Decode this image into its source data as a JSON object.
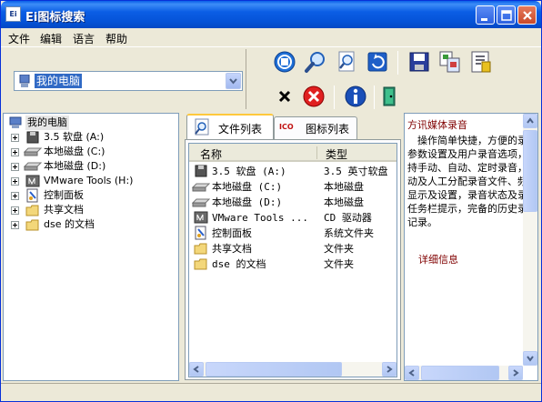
{
  "window": {
    "title": "Ei图标搜索",
    "app_icon_text": "Ei"
  },
  "menu": [
    "文件",
    "编辑",
    "语言",
    "帮助"
  ],
  "toolbar": {
    "location_value": "我的电脑",
    "buttons_row1": [
      "stop-icon",
      "search-icon",
      "find-file-icon",
      "refresh-icon",
      "save-icon",
      "copy-icon",
      "export-icon"
    ],
    "buttons_row2": [
      "clear-icon",
      "delete-icon",
      "info-icon",
      "exit-icon"
    ]
  },
  "tree": {
    "root": "我的电脑",
    "items": [
      {
        "label": "3.5 软盘 (A:)",
        "icon": "floppy-icon"
      },
      {
        "label": "本地磁盘 (C:)",
        "icon": "disk-icon"
      },
      {
        "label": "本地磁盘 (D:)",
        "icon": "disk-icon"
      },
      {
        "label": "VMware Tools (H:)",
        "icon": "cdrom-icon"
      },
      {
        "label": "控制面板",
        "icon": "control-panel-icon"
      },
      {
        "label": "共享文档",
        "icon": "folder-icon"
      },
      {
        "label": "dse 的文档",
        "icon": "folder-icon"
      }
    ]
  },
  "tabs": [
    {
      "label": "文件列表",
      "icon": "file-list-icon",
      "active": true
    },
    {
      "label": "图标列表",
      "icon": "ico-icon",
      "active": false
    }
  ],
  "ico_badge": "ICO",
  "listview": {
    "columns": [
      "名称",
      "类型"
    ],
    "rows": [
      {
        "name": "3.5 软盘 (A:)",
        "type": "3.5 英寸软盘",
        "icon": "floppy-icon"
      },
      {
        "name": "本地磁盘 (C:)",
        "type": "本地磁盘",
        "icon": "disk-icon"
      },
      {
        "name": "本地磁盘 (D:)",
        "type": "本地磁盘",
        "icon": "disk-icon"
      },
      {
        "name": "VMware Tools ...",
        "type": "CD 驱动器",
        "icon": "cdrom-icon"
      },
      {
        "name": "控制面板",
        "type": "系统文件夹",
        "icon": "control-panel-icon"
      },
      {
        "name": "共享文档",
        "type": "文件夹",
        "icon": "folder-icon"
      },
      {
        "name": "dse 的文档",
        "type": "文件夹",
        "icon": "folder-icon"
      }
    ]
  },
  "info": {
    "title": "方讯媒体录音",
    "body": "　操作简单快捷，方便的录样参数设置及用户录音选项，支持手动、自动、定时录音，自动及人工分配录音文件、频谱显示及设置，录音状态及录音任务栏提示，完备的历史录音记录。",
    "link": "详细信息"
  },
  "colors": {
    "title_bar": "#0553d8",
    "selection": "#316ac5",
    "info_accent": "#800000"
  }
}
